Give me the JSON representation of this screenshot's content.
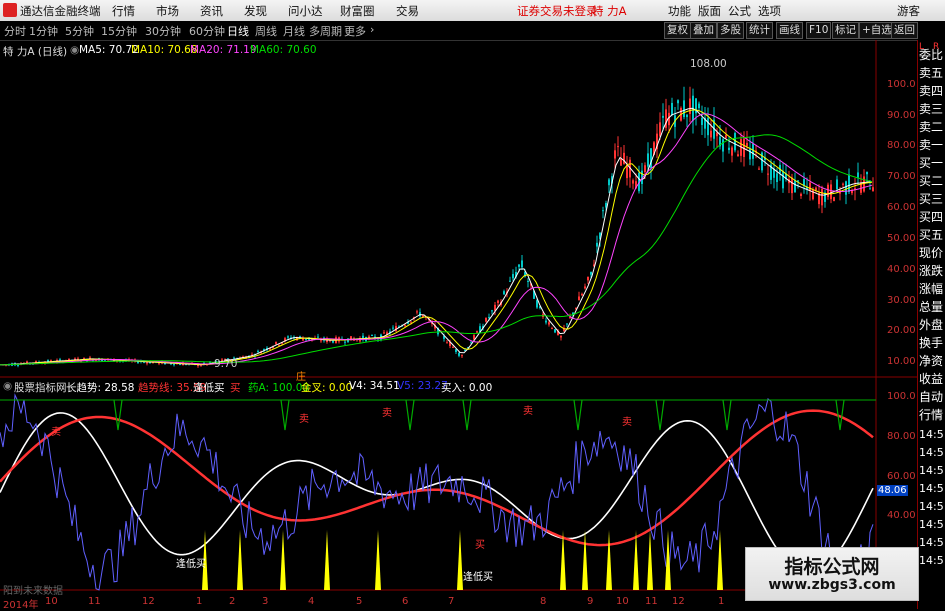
{
  "menubar": {
    "app_title": "通达信金融终端",
    "menus": [
      "行情",
      "市场",
      "资讯",
      "发现",
      "问小达",
      "财富圈",
      "交易"
    ],
    "login_warning": "证券交易未登录",
    "stock_name": "特 力A",
    "right_menus": [
      "功能",
      "版面",
      "公式",
      "选项"
    ],
    "guest_label": "游客"
  },
  "toolbar": {
    "periods": [
      "分时",
      "1分钟",
      "5分钟",
      "15分钟",
      "30分钟",
      "60分钟",
      "日线",
      "周线",
      "月线",
      "多周期",
      "更多"
    ],
    "active_period": "日线",
    "buttons": [
      "复权",
      "叠加",
      "多股",
      "统计",
      "画线",
      "F10",
      "标记",
      "+自选",
      "返回"
    ]
  },
  "price_panel": {
    "title": "特 力A (日线)",
    "ma": [
      {
        "label": "MA5: 70.72",
        "color": "#ffffff"
      },
      {
        "label": "MA10: 70.68",
        "color": "#ffff00"
      },
      {
        "label": "MA20: 71.19",
        "color": "#ff44ff"
      },
      {
        "label": "MA60: 70.60",
        "color": "#00dd00"
      }
    ],
    "high_label": "108.00",
    "low_label": "9.70",
    "yticks": [
      "100.0",
      "90.00",
      "80.00",
      "70.00",
      "60.00",
      "50.00",
      "40.00",
      "30.00",
      "20.00",
      "10.00"
    ]
  },
  "indicator_panel": {
    "name": "股票指标网",
    "items": [
      {
        "label": "长趋势: 28.58",
        "color": "#ffffff"
      },
      {
        "label": "趋势线: 35.59",
        "color": "#ff3333"
      },
      {
        "label": "逢低买",
        "color": "#ffffff"
      },
      {
        "label": "买",
        "color": "#ff3333"
      },
      {
        "label": "药A: 100.00",
        "color": "#00dd00"
      },
      {
        "label": "金叉: 0.00",
        "color": "#ffff00"
      },
      {
        "label": "V4: 34.51",
        "color": "#ffffff"
      },
      {
        "label": "V5: 23.27",
        "color": "#3333ff"
      },
      {
        "label": "买入: 0.00",
        "color": "#ffffff"
      }
    ],
    "yticks": [
      "100.0",
      "80.00",
      "60.00",
      "40.00"
    ],
    "current_value": "48.06",
    "annotations": [
      "卖",
      "卖",
      "卖",
      "卖",
      "卖",
      "逢低买",
      "逢低买",
      "买"
    ],
    "stop_marker": "庄"
  },
  "x_axis": [
    "2014年",
    "10",
    "11",
    "12",
    "1",
    "2",
    "3",
    "4",
    "5",
    "6",
    "7",
    "8",
    "9",
    "10",
    "11",
    "12",
    "1"
  ],
  "right_panel": {
    "top_items": [
      "L",
      "R"
    ],
    "items": [
      "委比",
      "卖五",
      "卖四",
      "卖三",
      "卖二",
      "卖一",
      "买一",
      "买二",
      "买三",
      "买四",
      "买五",
      "现价",
      "涨跌",
      "涨幅",
      "总量",
      "外盘",
      "换手",
      "净资",
      "收益",
      "自动",
      "行情"
    ],
    "times": [
      "14:5",
      "14:5",
      "14:5",
      "14:5",
      "14:5",
      "14:5",
      "14:5",
      "14:5"
    ]
  },
  "watermark": {
    "line1": "指标公式网",
    "line2": "www.zbgs3.com"
  },
  "status_text": "阳到未来数据",
  "colors": {
    "up": "#ff3333",
    "down": "#00c8c8",
    "axis": "#880000",
    "ma5": "#ffffff",
    "ma10": "#ffff00",
    "ma20": "#ff44ff",
    "ma60": "#00dd00"
  }
}
